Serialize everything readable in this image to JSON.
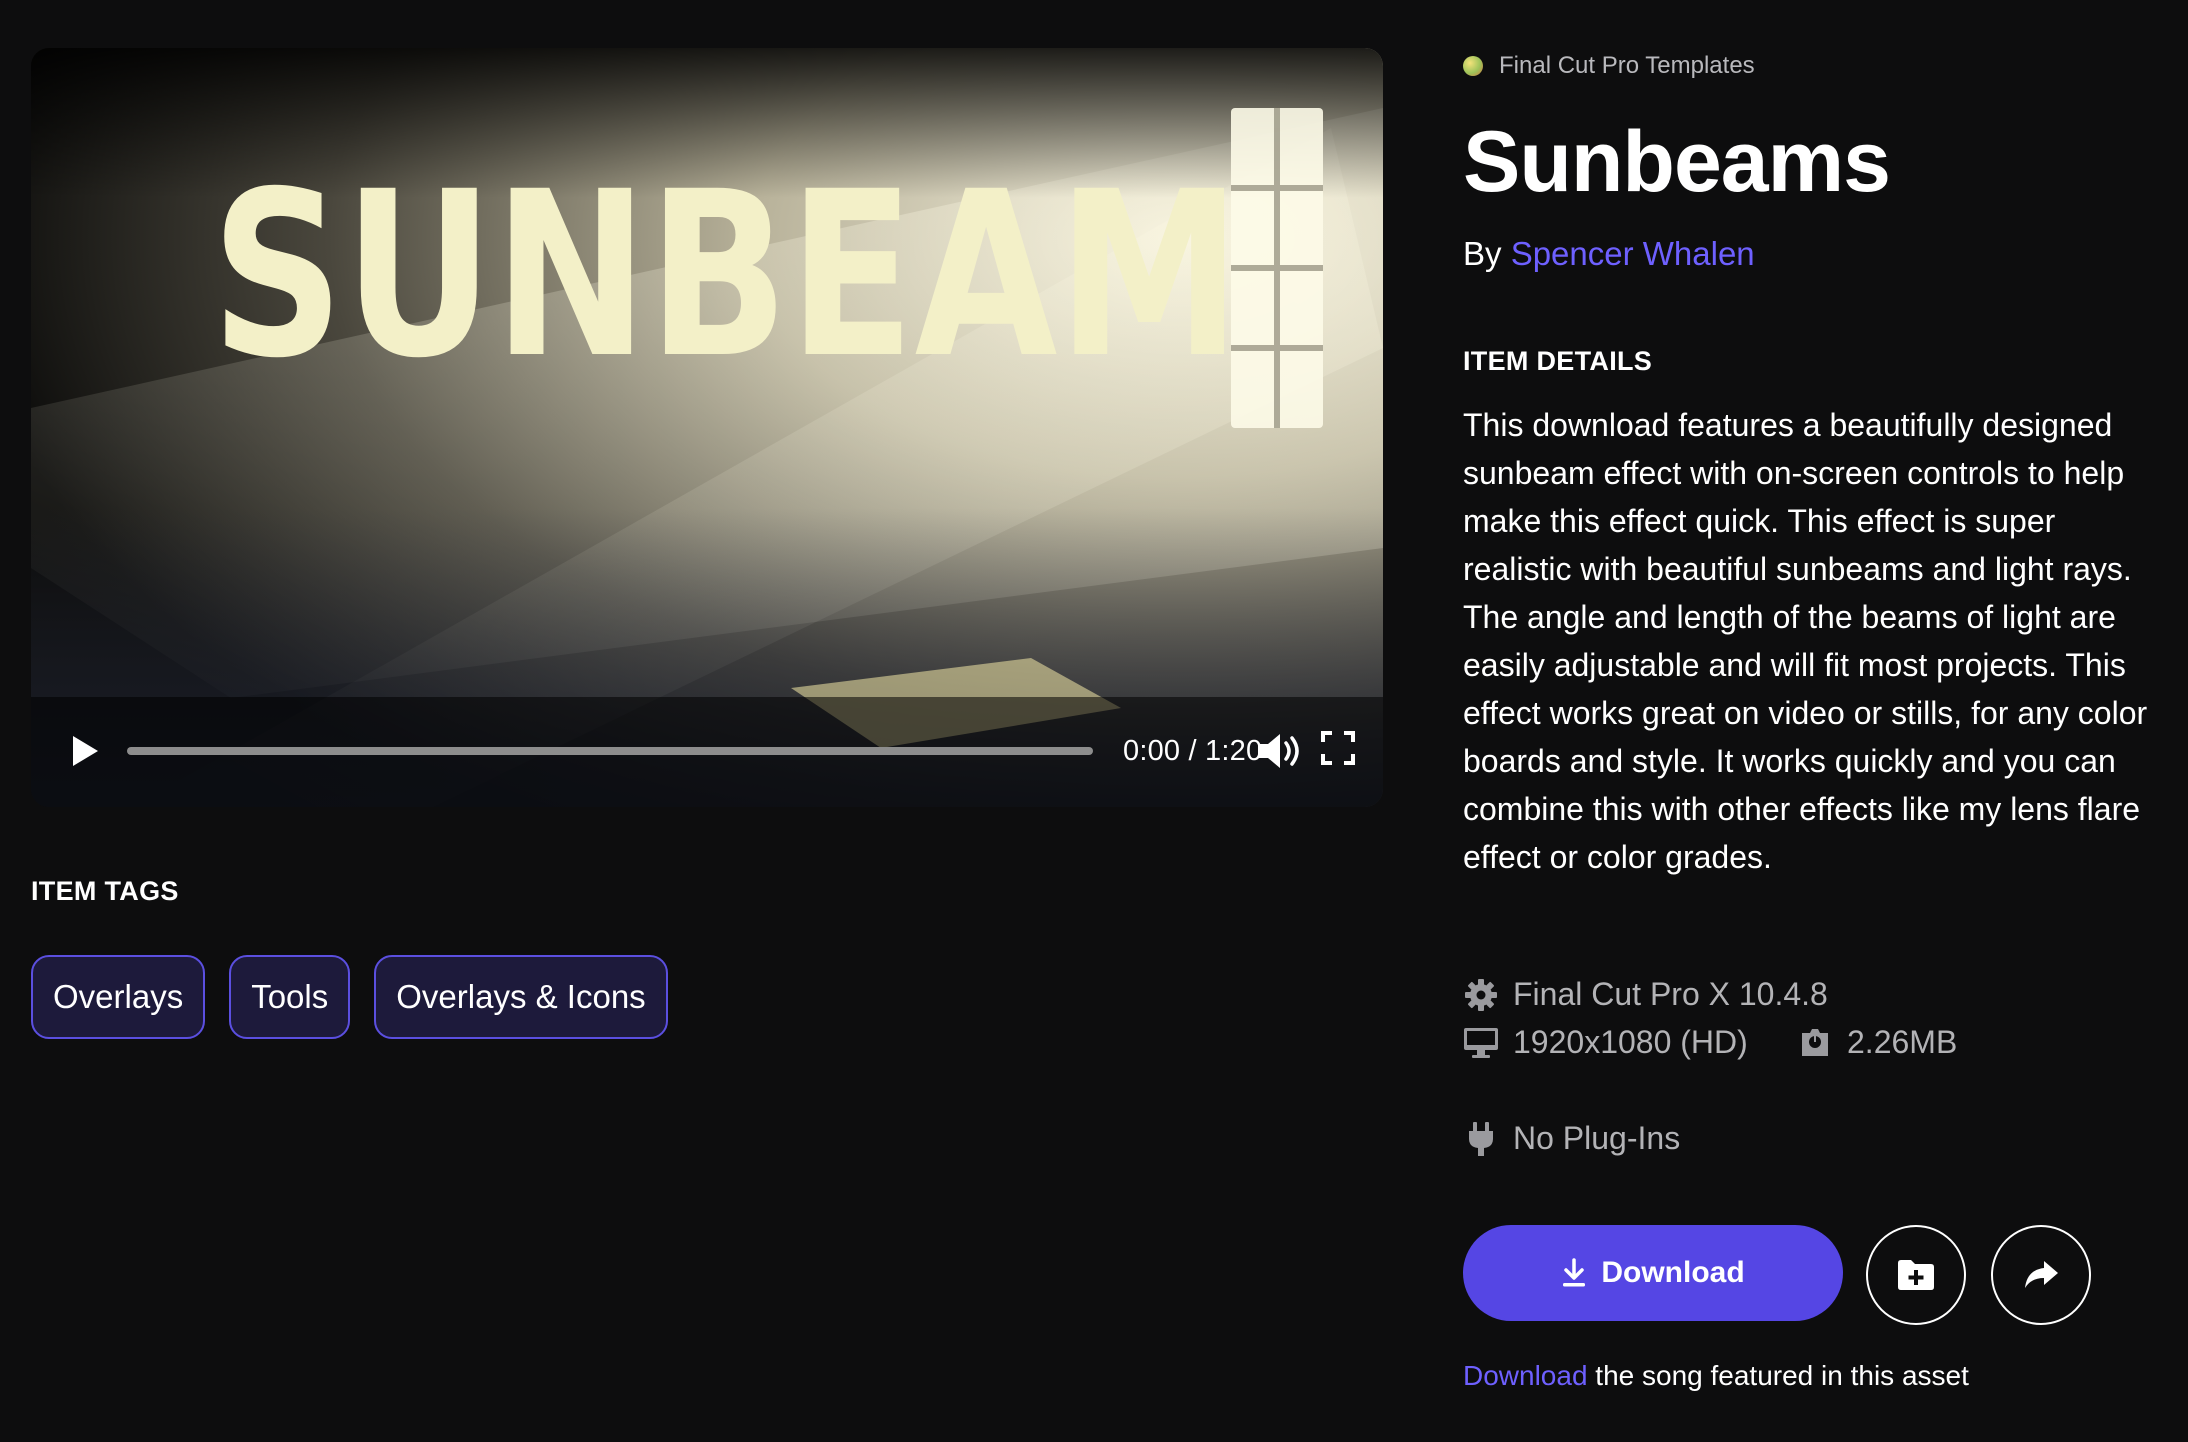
{
  "video": {
    "thumbnail_text": "SUNBEAM",
    "current_time": "0:00",
    "separator": " / ",
    "duration": "1:20",
    "progress_fraction": 0,
    "icons": {
      "play": "play-icon",
      "volume": "volume-icon",
      "fullscreen": "fullscreen-icon"
    }
  },
  "tags": {
    "heading": "ITEM TAGS",
    "items": [
      "Overlays",
      "Tools",
      "Overlays & Icons"
    ]
  },
  "item": {
    "category": "Final Cut Pro Templates",
    "title": "Sunbeams",
    "by_prefix": "By ",
    "author": "Spencer Whalen",
    "details_heading": "ITEM DETAILS",
    "description": "This download features a beautifully designed sunbeam effect with on-screen controls to help make this effect quick. This effect is super realistic with beautiful sunbeams and light rays. The angle and length of the beams of light are easily adjustable and will fit most projects. This effect works great on video or stills, for any color boards and style. It works quickly and you can combine this with other effects like my lens flare effect or color grades.",
    "specs": {
      "software": "Final Cut Pro X 10.4.8",
      "resolution": "1920x1080 (HD)",
      "size": "2.26MB",
      "plugins": "No Plug-Ins"
    }
  },
  "actions": {
    "download_label": "Download",
    "song_link": "Download",
    "song_text": " the song featured in this asset"
  },
  "colors": {
    "accent": "#5546e4",
    "link": "#6e60ff",
    "background": "#0d0d0e",
    "tag_border": "#5b4fe0",
    "tag_fill": "#1d1a3b"
  }
}
